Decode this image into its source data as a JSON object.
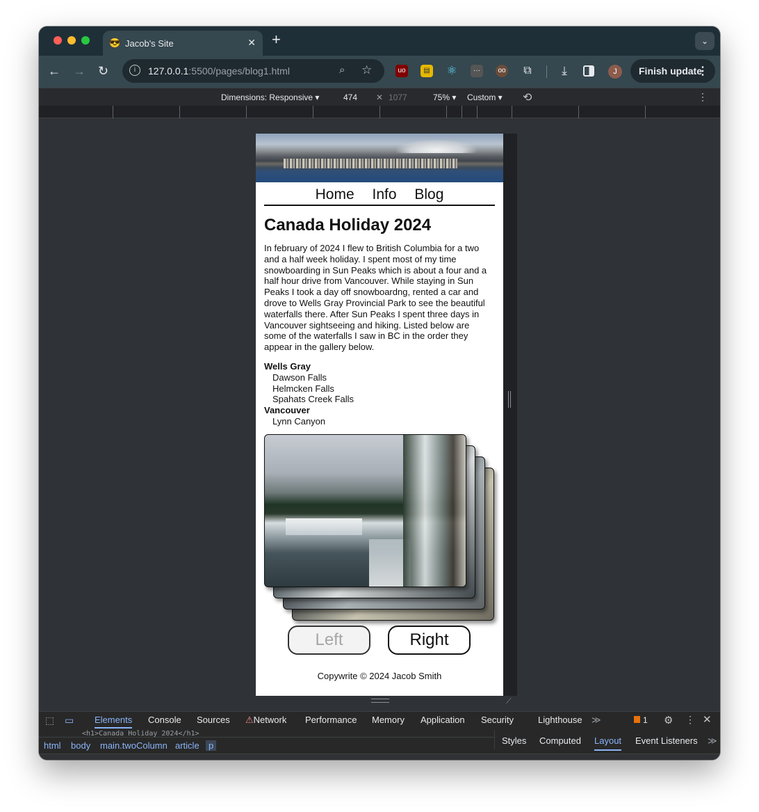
{
  "browser": {
    "tab_title": "Jacob's Site",
    "url_host": "127.0.0.1",
    "url_rest": ":5500/pages/blog1.html",
    "finish_update_label": "Finish update",
    "avatar_initial": "J"
  },
  "device_toolbar": {
    "dimensions": "Dimensions: Responsive",
    "width": "474",
    "height": "1077",
    "zoom": "75%",
    "throttle": "Custom"
  },
  "page": {
    "nav": [
      "Home",
      "Info",
      "Blog"
    ],
    "title": "Canada Holiday 2024",
    "body": "In february of 2024 I flew to British Columbia for a two and a half week holiday. I spent most of my time snowboarding in Sun Peaks which is about a four and a half hour drive from Vancouver. While staying in Sun Peaks I took a day off snowboardng, rented a car and drove to Wells Gray Provincial Park to see the beautiful waterfalls there. After Sun Peaks I spent three days in Vancouver sightseeing and hiking. Listed below are some of the waterfalls I saw in BC in the order they appear in the gallery below.",
    "regions": [
      {
        "name": "Wells Gray",
        "falls": [
          "Dawson Falls",
          "Helmcken Falls",
          "Spahats Creek Falls"
        ]
      },
      {
        "name": "Vancouver",
        "falls": [
          "Lynn Canyon"
        ]
      }
    ],
    "left_button": "Left",
    "right_button": "Right",
    "footer": "Copywrite © 2024 Jacob Smith"
  },
  "devtools": {
    "tabs": [
      "Elements",
      "Console",
      "Sources",
      "Network",
      "Performance",
      "Memory",
      "Application",
      "Security",
      "Lighthouse"
    ],
    "active_tab": "Elements",
    "issues_count": "1",
    "code_snippet": "<h1>Canada Holiday 2024</h1>",
    "breadcrumbs": [
      "html",
      "body",
      "main.twoColumn",
      "article",
      "p"
    ],
    "side_tabs": [
      "Styles",
      "Computed",
      "Layout",
      "Event Listeners"
    ],
    "active_side_tab": "Layout"
  },
  "colors": {
    "accent": "#8ab4f8",
    "chrome_toolbar": "#35474f"
  }
}
